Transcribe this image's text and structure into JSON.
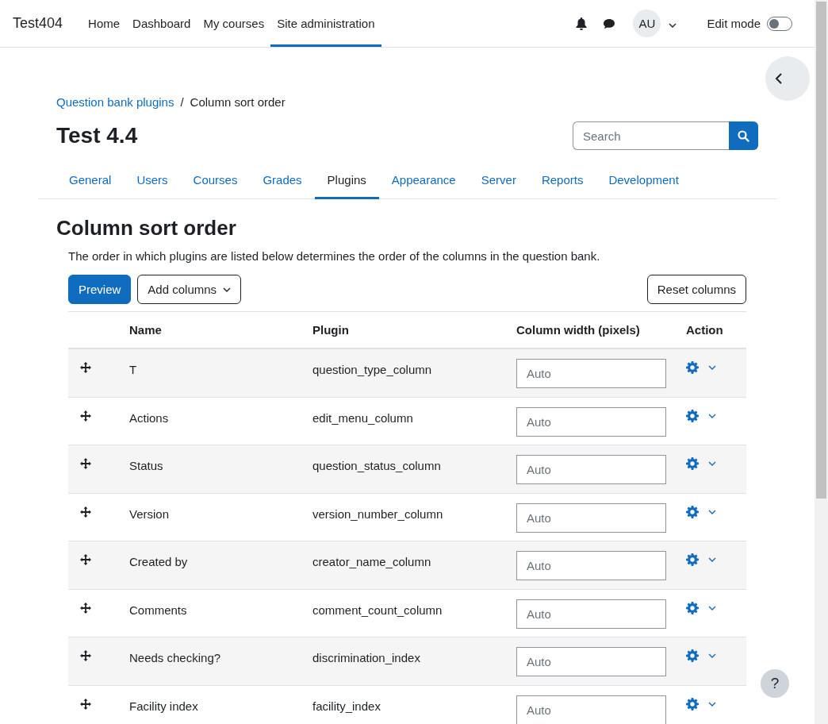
{
  "navbar": {
    "brand": "Test404",
    "links": [
      {
        "label": "Home",
        "selected": false
      },
      {
        "label": "Dashboard",
        "selected": false
      },
      {
        "label": "My courses",
        "selected": false
      },
      {
        "label": "Site administration",
        "selected": true
      }
    ],
    "avatar": "AU",
    "edit_mode": {
      "label": "Edit mode",
      "on": false
    }
  },
  "breadcrumb": {
    "items": [
      {
        "label": "Question bank plugins",
        "kind": "link"
      },
      {
        "label": "Column sort order",
        "kind": "current"
      }
    ],
    "separator": "/"
  },
  "page_title": "Test 4.4",
  "search": {
    "placeholder": "Search"
  },
  "tabs": [
    {
      "label": "General",
      "selected": false
    },
    {
      "label": "Users",
      "selected": false
    },
    {
      "label": "Courses",
      "selected": false
    },
    {
      "label": "Grades",
      "selected": false
    },
    {
      "label": "Plugins",
      "selected": true
    },
    {
      "label": "Appearance",
      "selected": false
    },
    {
      "label": "Server",
      "selected": false
    },
    {
      "label": "Reports",
      "selected": false
    },
    {
      "label": "Development",
      "selected": false
    }
  ],
  "heading": "Column sort order",
  "description": "The order in which plugins are listed below determines the order of the columns in the question bank.",
  "toolbar": {
    "preview": "Preview",
    "add_columns": "Add columns",
    "reset": "Reset columns"
  },
  "table": {
    "columns": [
      "Name",
      "Plugin",
      "Column width (pixels)",
      "Action"
    ],
    "rows": [
      {
        "name": "T",
        "plugin": "question_type_column",
        "width_placeholder": "Auto"
      },
      {
        "name": "Actions",
        "plugin": "edit_menu_column",
        "width_placeholder": "Auto"
      },
      {
        "name": "Status",
        "plugin": "question_status_column",
        "width_placeholder": "Auto"
      },
      {
        "name": "Version",
        "plugin": "version_number_column",
        "width_placeholder": "Auto"
      },
      {
        "name": "Created by",
        "plugin": "creator_name_column",
        "width_placeholder": "Auto"
      },
      {
        "name": "Comments",
        "plugin": "comment_count_column",
        "width_placeholder": "Auto"
      },
      {
        "name": "Needs checking?",
        "plugin": "discrimination_index",
        "width_placeholder": "Auto"
      },
      {
        "name": "Facility index",
        "plugin": "facility_index",
        "width_placeholder": "Auto"
      }
    ]
  },
  "help": "?"
}
